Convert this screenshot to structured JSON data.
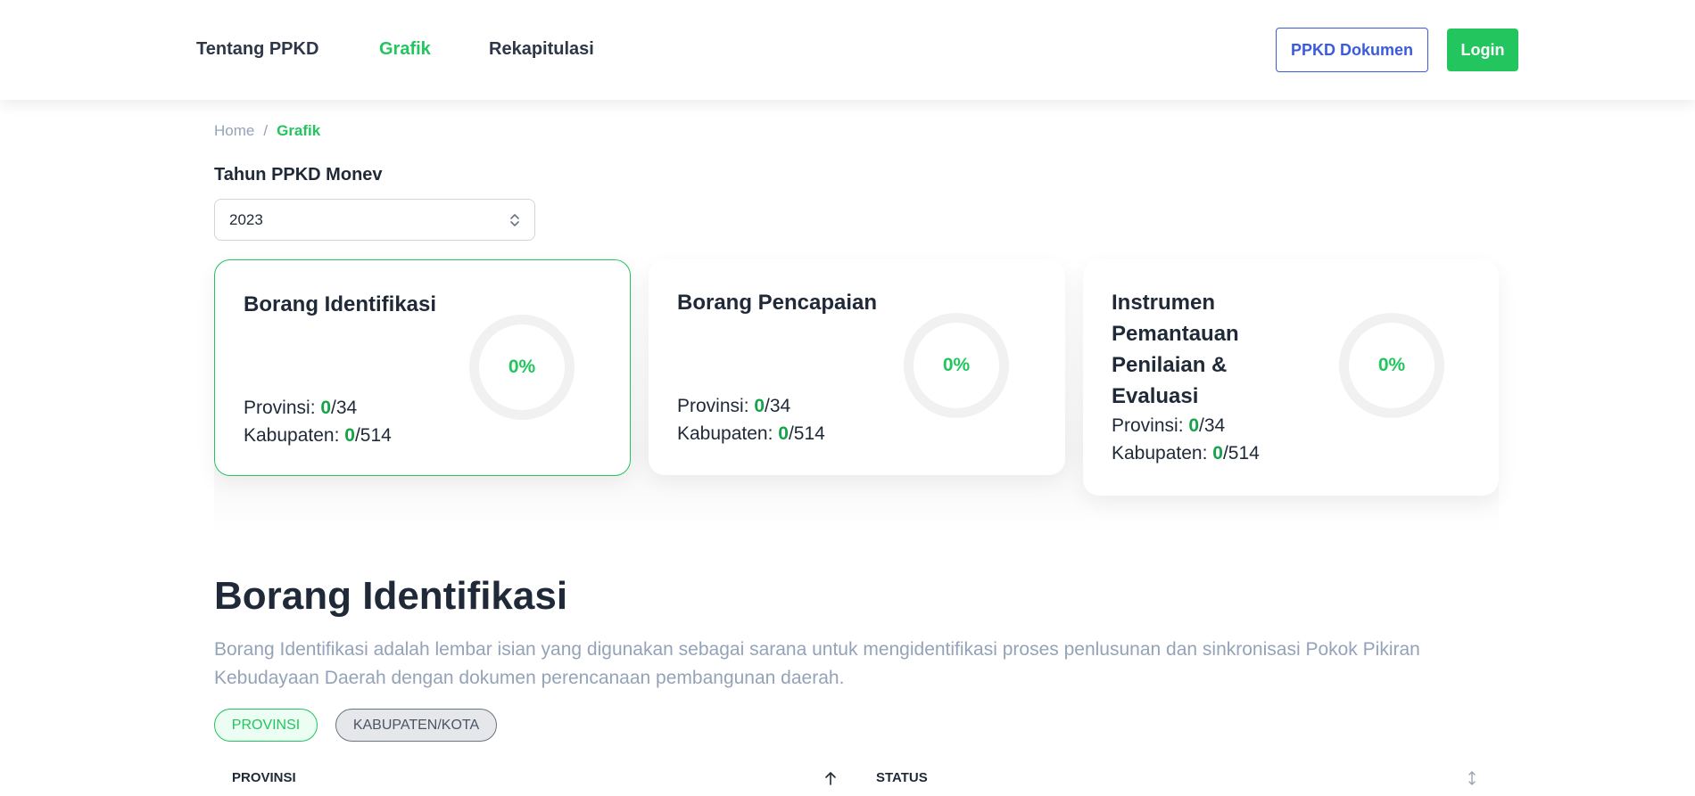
{
  "header": {
    "nav": [
      "Tentang PPKD",
      "Grafik",
      "Rekapitulasi"
    ],
    "active_nav": "Grafik",
    "doc_button": "PPKD Dokumen",
    "login_button": "Login",
    "accent_color": "#22c55e",
    "doc_button_color": "#3b5bdb"
  },
  "breadcrumb": {
    "home": "Home",
    "separator": "/",
    "current": "Grafik"
  },
  "filter": {
    "label": "Tahun PPKD Monev",
    "selected": "2023"
  },
  "cards": [
    {
      "title": "Borang Identifikasi",
      "percent": "0%",
      "provinsi_label": "Provinsi: ",
      "provinsi_value": "0",
      "provinsi_total": "/34",
      "kabupaten_label": "Kabupaten: ",
      "kabupaten_value": "0",
      "kabupaten_total": "/514"
    },
    {
      "title": "Borang Pencapaian",
      "percent": "0%",
      "provinsi_label": "Provinsi: ",
      "provinsi_value": "0",
      "provinsi_total": "/34",
      "kabupaten_label": "Kabupaten: ",
      "kabupaten_value": "0",
      "kabupaten_total": "/514"
    },
    {
      "title": "Instrumen Pemantauan Penilaian & Evaluasi",
      "percent": "0%",
      "provinsi_label": "Provinsi: ",
      "provinsi_value": "0",
      "provinsi_total": "/34",
      "kabupaten_label": "Kabupaten: ",
      "kabupaten_value": "0",
      "kabupaten_total": "/514"
    }
  ],
  "section": {
    "title": "Borang Identifikasi",
    "description": "Borang Identifikasi adalah lembar isian yang digunakan sebagai sarana untuk mengidentifikasi proses penlusunan dan sinkronisasi Pokok Pikiran Kebudayaan Daerah dengan dokumen perencanaan pembangunan daerah.",
    "tabs": [
      "PROVINSI",
      "KABUPATEN/KOTA"
    ],
    "active_tab": "PROVINSI"
  },
  "table": {
    "columns": [
      "PROVINSI",
      "STATUS"
    ]
  }
}
